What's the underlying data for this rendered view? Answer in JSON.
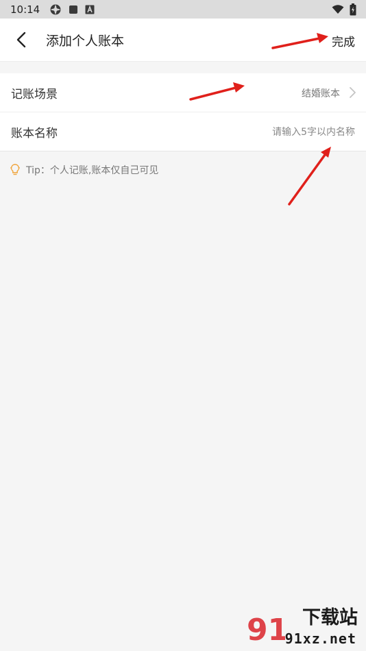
{
  "status_bar": {
    "time": "10:14",
    "icons_left": [
      "settings-gear-icon",
      "square-notification-icon",
      "a-notification-icon"
    ],
    "icons_right": [
      "wifi-icon",
      "battery-icon"
    ]
  },
  "header": {
    "title": "添加个人账本",
    "done_label": "完成"
  },
  "form": {
    "scene_label": "记账场景",
    "scene_value": "结婚账本",
    "name_label": "账本名称",
    "name_placeholder": "请输入5字以内名称",
    "name_value": ""
  },
  "tip": {
    "text": "Tip：个人记账,账本仅自己可见"
  },
  "watermark": {
    "site": "91xz.net",
    "brand": "下载站",
    "logo": "91"
  },
  "colors": {
    "annotation_arrow": "#e0201b",
    "tip_icon": "#f0a43a",
    "watermark_red": "#d9232a"
  }
}
